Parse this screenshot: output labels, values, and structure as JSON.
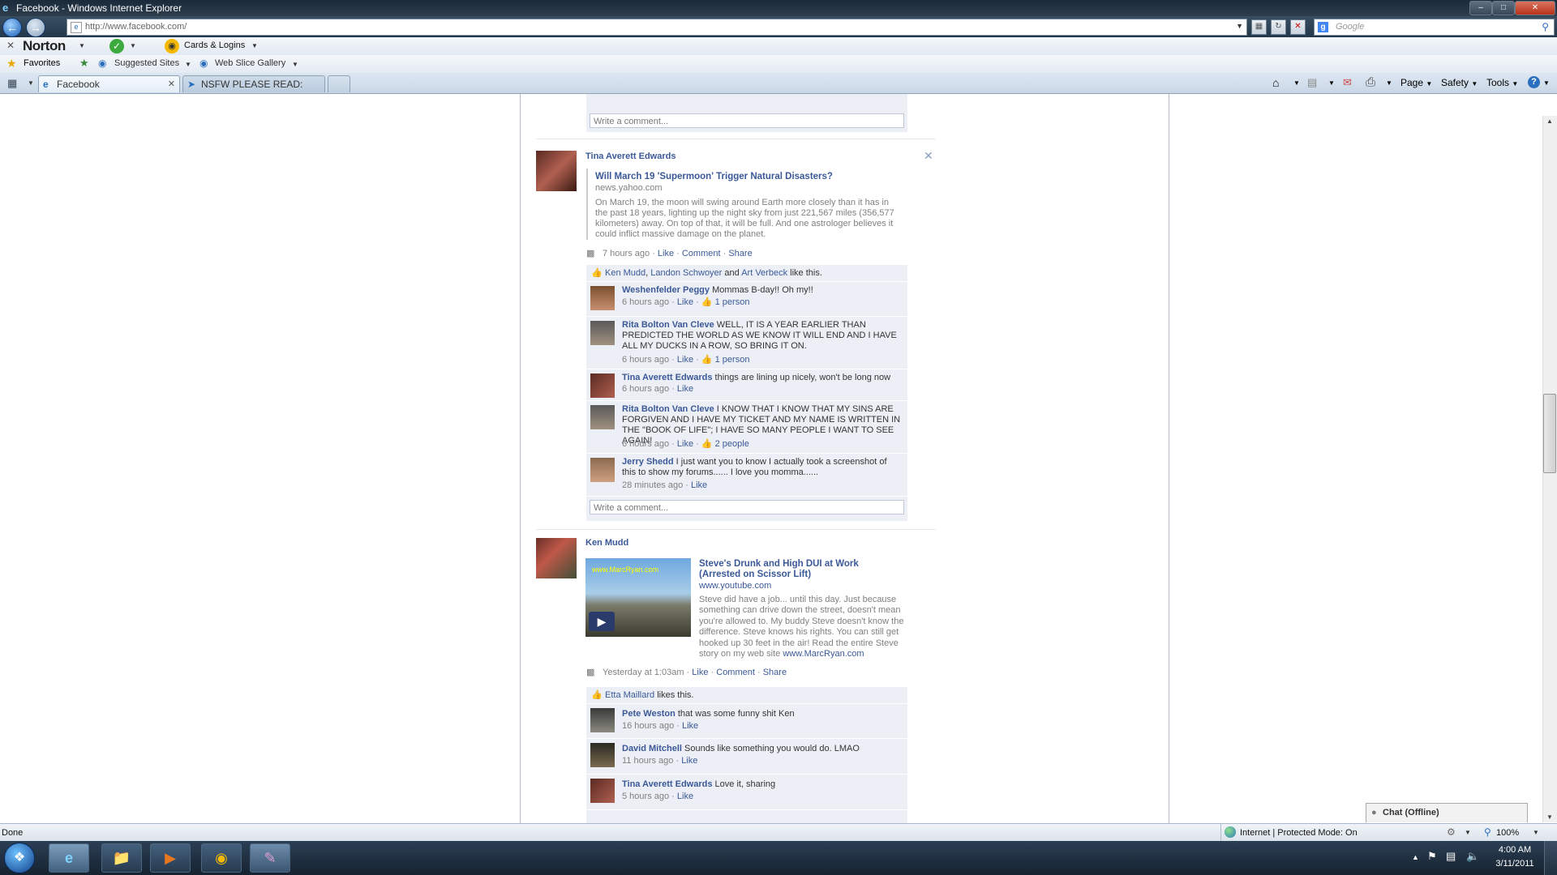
{
  "window": {
    "title": "Facebook - Windows Internet Explorer"
  },
  "address": {
    "url": "http://www.facebook.com/"
  },
  "search": {
    "placeholder": "Google"
  },
  "norton": {
    "brand": "Norton",
    "cards": "Cards & Logins"
  },
  "favbar": {
    "favorites": "Favorites",
    "suggested": "Suggested Sites",
    "webslice": "Web Slice Gallery"
  },
  "tabs": [
    {
      "label": "Facebook"
    },
    {
      "label": "NSFW PLEASE READ: NSF..."
    }
  ],
  "cmdbar": {
    "page": "Page",
    "safety": "Safety",
    "tools": "Tools"
  },
  "write_comment": "Write a comment...",
  "post1": {
    "author": "Tina Averett Edwards",
    "link_title": "Will March 19 'Supermoon' Trigger Natural Disasters?",
    "link_domain": "news.yahoo.com",
    "link_desc": "On March 19, the moon will swing around Earth more closely than it has in the past 18 years, lighting up the night sky from just 221,567 miles (356,577 kilometers) away. On top of that, it will be full. And one astrologer believes it could inflict massive damage on the planet.",
    "time": "7 hours ago",
    "like": "Like",
    "comment": "Comment",
    "share": "Share",
    "likers": [
      "Ken Mudd",
      "Landon Schwoyer",
      "Art Verbeck"
    ],
    "like_sep1": ",",
    "like_and": "and",
    "like_tail": "like this.",
    "comments": [
      {
        "name": "Weshenfelder Peggy",
        "text": "Mommas B-day!! Oh my!!",
        "time": "6 hours ago",
        "like": "Like",
        "likes": "1 person"
      },
      {
        "name": "Rita Bolton Van Cleve",
        "text": "WELL, IT IS A YEAR EARLIER THAN PREDICTED THE WORLD AS WE KNOW IT WILL END AND I HAVE ALL MY DUCKS IN A ROW, SO BRING IT ON.",
        "time": "6 hours ago",
        "like": "Like",
        "likes": "1 person"
      },
      {
        "name": "Tina Averett Edwards",
        "text": "things are lining up nicely, won't be long now",
        "time": "6 hours ago",
        "like": "Like",
        "likes": ""
      },
      {
        "name": "Rita Bolton Van Cleve",
        "text": "I KNOW THAT I KNOW THAT MY SINS ARE FORGIVEN AND I HAVE MY TICKET AND MY NAME IS WRITTEN IN THE \"BOOK OF LIFE\"; I HAVE SO MANY PEOPLE I WANT TO SEE AGAIN!",
        "time": "6 hours ago",
        "like": "Like",
        "likes": "2 people"
      },
      {
        "name": "Jerry Shedd",
        "text": "I just want you to know I actually took a screenshot of this to show my forums...... I love you momma......",
        "time": "28 minutes ago",
        "like": "Like",
        "likes": ""
      }
    ]
  },
  "post2": {
    "author": "Ken Mudd",
    "thumb_watermark": "www.MarcRyan.com",
    "link_title": "Steve's Drunk and High DUI at Work (Arrested on Scissor Lift)",
    "link_domain": "www.youtube.com",
    "link_desc": "Steve did have a job... until this day. Just because something can drive down the street, doesn't mean you're allowed to. My buddy Steve doesn't know the difference. Steve knows his rights. You can still get hooked up 30 feet in the air! Read the entire Steve story on my web site",
    "link_desc_link": "www.MarcRyan.com",
    "time": "Yesterday at 1:03am",
    "like": "Like",
    "comment": "Comment",
    "share": "Share",
    "liker": "Etta Maillard",
    "like_tail": "likes this.",
    "comments": [
      {
        "name": "Pete Weston",
        "text": "that was some funny shit Ken",
        "time": "16 hours ago",
        "like": "Like"
      },
      {
        "name": "David Mitchell",
        "text": "Sounds like something you would do. LMAO",
        "time": "11 hours ago",
        "like": "Like"
      },
      {
        "name": "Tina Averett Edwards",
        "text": "Love it, sharing",
        "time": "5 hours ago",
        "like": "Like"
      }
    ]
  },
  "chat": {
    "label": "Chat (Offline)"
  },
  "statusbar": {
    "left": "Done",
    "zone": "Internet | Protected Mode: On",
    "zoom": "100%"
  },
  "clock": {
    "time": "4:00 AM",
    "date": "3/11/2011"
  },
  "colors": {
    "fb_link": "#3b5998",
    "comment_bg": "#eceff5"
  }
}
